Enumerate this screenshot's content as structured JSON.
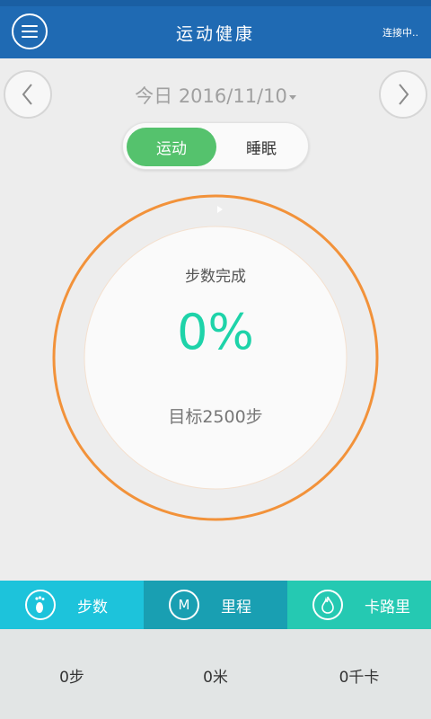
{
  "header": {
    "title": "运动健康",
    "connection_status": "连接中.."
  },
  "date_selector": {
    "label": "今日 2016/11/10"
  },
  "mode_toggle": {
    "options": [
      "运动",
      "睡眠"
    ],
    "selected": "运动"
  },
  "progress": {
    "caption": "步数完成",
    "percent_text": "0%",
    "percent_value": 0,
    "goal_text": "目标2500步"
  },
  "tabs": [
    {
      "label": "步数",
      "icon": "footprint-icon"
    },
    {
      "label": "里程",
      "icon": "m-letter-icon",
      "icon_text": "M"
    },
    {
      "label": "卡路里",
      "icon": "flame-icon"
    }
  ],
  "values": {
    "steps": "0步",
    "distance": "0米",
    "calories": "0千卡"
  },
  "colors": {
    "header": "#1f6ab3",
    "accent_green": "#55c26d",
    "ring_orange": "#f2923a",
    "percent_teal": "#1ed3a9",
    "tab_steps": "#1dc3db",
    "tab_distance": "#199fb2",
    "tab_calories": "#25c9b2"
  }
}
